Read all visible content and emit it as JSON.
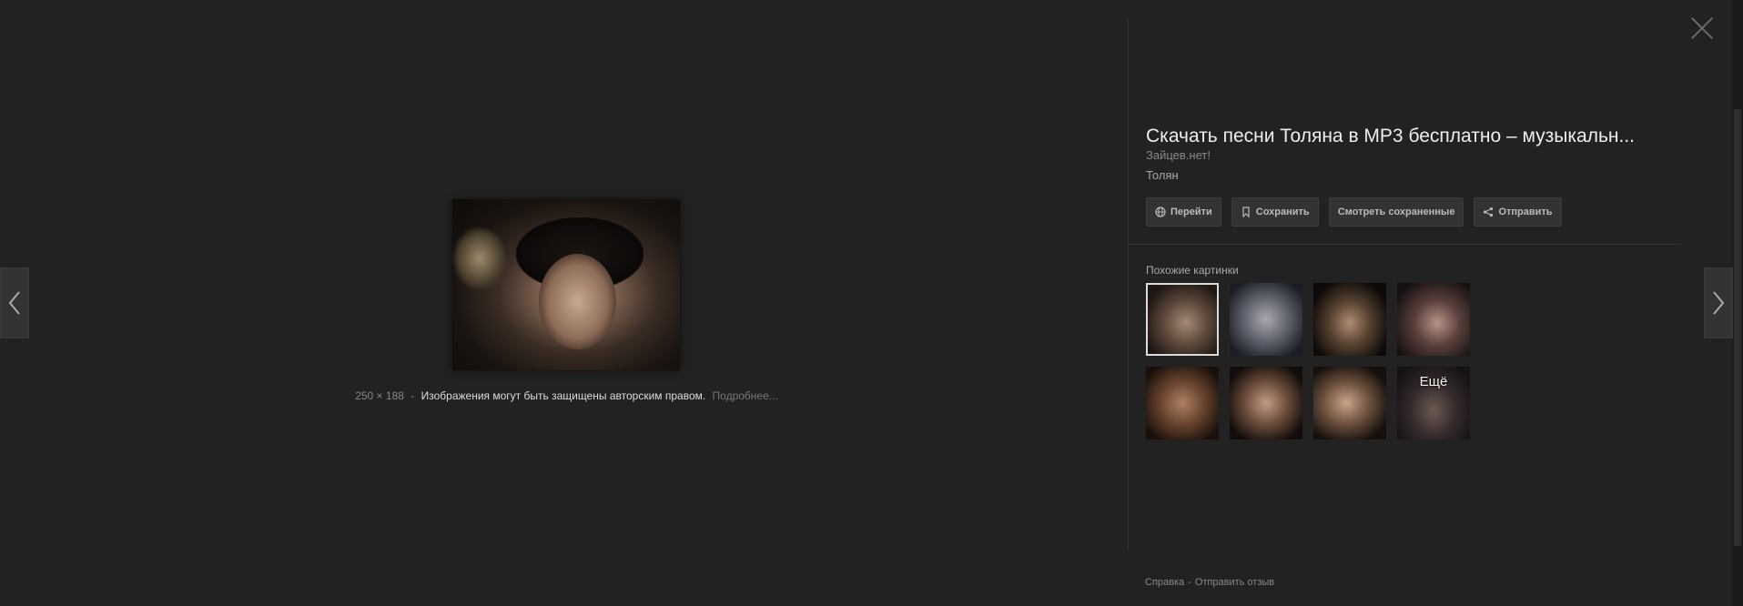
{
  "viewer": {
    "close_icon": "close-icon",
    "prev_icon": "chevron-left-icon",
    "next_icon": "chevron-right-icon"
  },
  "image_meta": {
    "size": "250 × 188",
    "separator": "-",
    "copyright": "Изображения могут быть защищены авторским правом.",
    "more_link": "Подробнее..."
  },
  "info": {
    "title": "Скачать песни Толяна в MP3 бесплатно – музыкальн...",
    "site": "Зайцев.нет!",
    "description": "Толян"
  },
  "actions": [
    {
      "label": "Перейти",
      "icon": "globe-icon"
    },
    {
      "label": "Сохранить",
      "icon": "bookmark-icon"
    },
    {
      "label": "Смотреть сохраненные",
      "icon": ""
    },
    {
      "label": "Отправить",
      "icon": "share-icon"
    }
  ],
  "similar": {
    "label": "Похожие картинки",
    "more_label": "Ещё",
    "thumb_count": 8
  },
  "footer": {
    "help": "Справка",
    "separator": "-",
    "feedback": "Отправить отзыв"
  },
  "colors": {
    "background": "#222222",
    "panel_divider": "#333333",
    "button_bg": "#333333",
    "selected_border": "#dcdcdc"
  }
}
